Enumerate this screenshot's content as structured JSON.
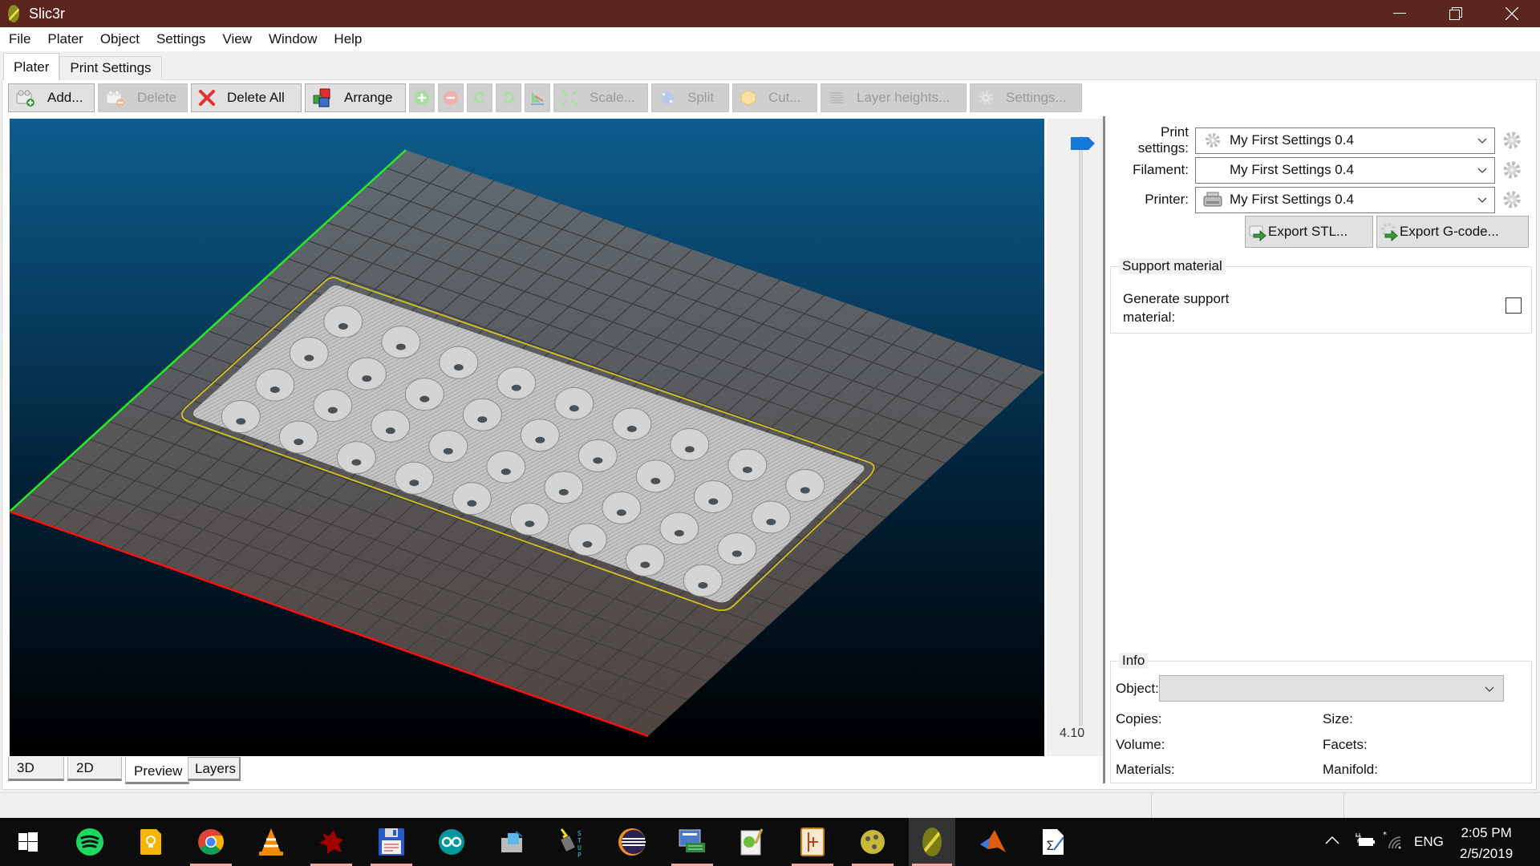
{
  "window": {
    "title": "Slic3r",
    "controls": {
      "minimize": "—",
      "restore": "❐",
      "close": "✕"
    }
  },
  "menu": [
    "File",
    "Plater",
    "Object",
    "Settings",
    "View",
    "Window",
    "Help"
  ],
  "tabs": [
    {
      "label": "Plater",
      "active": true
    },
    {
      "label": "Print Settings",
      "active": false
    }
  ],
  "toolbar": {
    "add": "Add...",
    "delete": "Delete",
    "delete_all": "Delete All",
    "arrange": "Arrange",
    "increase_icon": "plus-circle-icon",
    "decrease_icon": "minus-circle-icon",
    "rotate_ccw_icon": "rotate-left-icon",
    "rotate_cw_icon": "rotate-right-icon",
    "mirror_icon": "mirror-icon",
    "scale": "Scale...",
    "split": "Split",
    "cut": "Cut...",
    "layer_heights": "Layer heights...",
    "settings": "Settings..."
  },
  "viewport": {
    "view_mode": "Preview",
    "colors": {
      "background_top": "#0d5d8e",
      "background_bottom": "#000000",
      "bed": "#5b5b5b",
      "x_axis": "#ff0000",
      "y_axis": "#00dd00",
      "skirt": "#d4c020",
      "object": "#c8c8c8"
    }
  },
  "layer_slider": {
    "value": "4.10",
    "position_fraction": 1.0,
    "thumb_color": "#1478d4"
  },
  "bottom_tabs": [
    {
      "label": "3D",
      "active": false
    },
    {
      "label": "2D",
      "active": false
    },
    {
      "label": "Preview",
      "active": true
    },
    {
      "label": "Layers",
      "active": false
    }
  ],
  "presets": {
    "print_label": "Print settings:",
    "print_value": "My First Settings 0.4",
    "filament_label": "Filament:",
    "filament_value": "My First Settings 0.4",
    "printer_label": "Printer:",
    "printer_value": "My First Settings 0.4"
  },
  "export": {
    "stl": "Export STL...",
    "gcode": "Export G-code..."
  },
  "support": {
    "title": "Support material",
    "generate_label": "Generate support material:",
    "generate_checked": false
  },
  "info": {
    "title": "Info",
    "object_label": "Object:",
    "object_value": "",
    "copies": "Copies:",
    "size": "Size:",
    "volume": "Volume:",
    "facets": "Facets:",
    "materials": "Materials:",
    "manifold": "Manifold:"
  },
  "taskbar": {
    "apps": [
      {
        "name": "windows-start-icon",
        "running": false
      },
      {
        "name": "spotify-icon",
        "running": false
      },
      {
        "name": "google-keep-icon",
        "running": false
      },
      {
        "name": "chrome-icon",
        "running": true
      },
      {
        "name": "vlc-icon",
        "running": false
      },
      {
        "name": "red-app-icon",
        "running": true
      },
      {
        "name": "floppy-disk-icon",
        "running": true
      },
      {
        "name": "arduino-icon",
        "running": false
      },
      {
        "name": "tool-app-icon",
        "running": false
      },
      {
        "name": "stup-app-icon",
        "running": false
      },
      {
        "name": "eclipse-icon",
        "running": false
      },
      {
        "name": "utility-app-icon",
        "running": true
      },
      {
        "name": "notepad-pp-icon",
        "running": false
      },
      {
        "name": "circuit-app-icon",
        "running": true
      },
      {
        "name": "ball-app-icon",
        "running": true
      },
      {
        "name": "slic3r-icon",
        "running": true,
        "active": true
      },
      {
        "name": "matlab-icon",
        "running": false
      },
      {
        "name": "math-editor-icon",
        "running": false
      }
    ],
    "tray": {
      "language": "ENG",
      "time": "2:05 PM",
      "date": "2/5/2019"
    }
  }
}
